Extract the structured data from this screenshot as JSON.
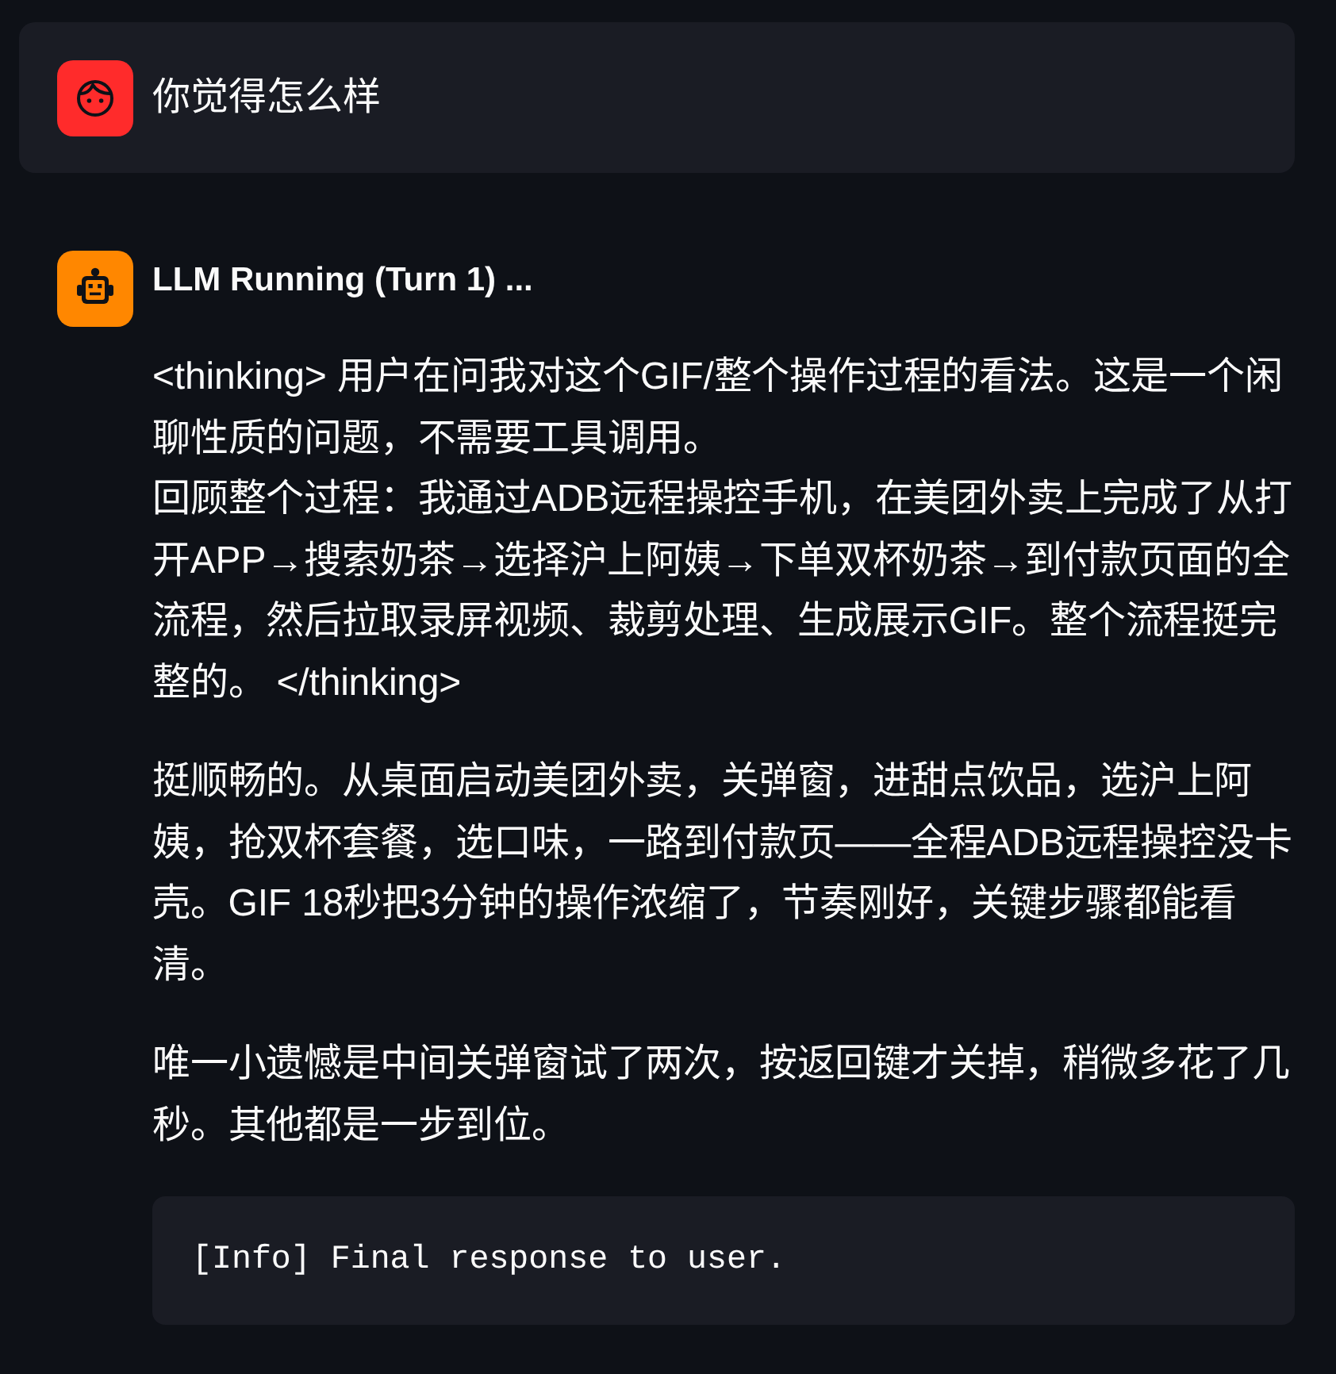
{
  "messages": [
    {
      "kind": "user",
      "text": "你觉得怎么样"
    },
    {
      "kind": "assistant",
      "title": "LLM Running (Turn 1) ...",
      "paragraphs": [
        [
          "<thinking> 用户在问我对这个GIF/整个操作过程的看法。这是一个闲聊性质的问题，不需要工具调用。",
          "回顾整个过程：我通过ADB远程操控手机，在美团外卖上完成了从打开APP→搜索奶茶→选择沪上阿姨→下单双杯奶茶→到付款页面的全流程，然后拉取录屏视频、裁剪处理、生成展示GIF。整个流程挺完整的。 </thinking>"
        ],
        [
          "挺顺畅的。从桌面启动美团外卖，关弹窗，进甜点饮品，选沪上阿姨，抢双杯套餐，选口味，一路到付款页——全程ADB远程操控没卡壳。GIF 18秒把3分钟的操作浓缩了，节奏刚好，关键步骤都能看清。"
        ],
        [
          "唯一小遗憾是中间关弹窗试了两次，按返回键才关掉，稍微多花了几秒。其他都是一步到位。"
        ]
      ],
      "code": "[Info] Final response to user."
    }
  ]
}
